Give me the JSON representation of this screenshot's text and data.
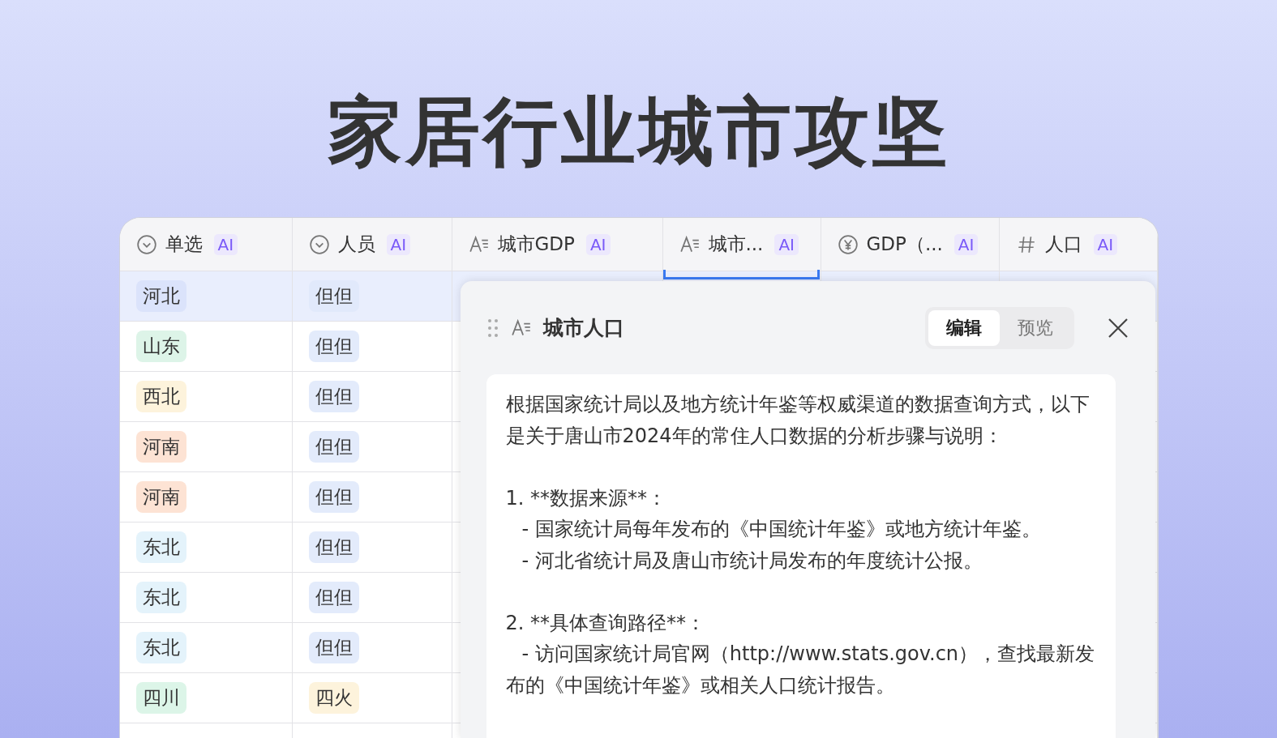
{
  "title": "家居行业城市攻坚",
  "table": {
    "columns": [
      {
        "kind": "select",
        "label": "单选",
        "badge": "AI"
      },
      {
        "kind": "select",
        "label": "人员",
        "badge": "AI"
      },
      {
        "kind": "text",
        "label": "城市GDP",
        "badge": "AI"
      },
      {
        "kind": "text",
        "label": "城市...",
        "badge": "AI"
      },
      {
        "kind": "currency",
        "label": "GDP（...",
        "badge": "AI"
      },
      {
        "kind": "number",
        "label": "人口",
        "badge": "AI"
      }
    ],
    "rows": [
      {
        "selected": true,
        "region": {
          "text": "河北",
          "color": "#dbe3fb"
        },
        "person": {
          "text": "但但",
          "color": "#e1e9fb"
        }
      },
      {
        "selected": false,
        "region": {
          "text": "山东",
          "color": "#ddf4e8"
        },
        "person": {
          "text": "但但",
          "color": "#e3ebfb"
        }
      },
      {
        "selected": false,
        "region": {
          "text": "西北",
          "color": "#fdf3dc"
        },
        "person": {
          "text": "但但",
          "color": "#e3ebfb"
        }
      },
      {
        "selected": false,
        "region": {
          "text": "河南",
          "color": "#fde3d4"
        },
        "person": {
          "text": "但但",
          "color": "#e3ebfb"
        }
      },
      {
        "selected": false,
        "region": {
          "text": "河南",
          "color": "#fde3d4"
        },
        "person": {
          "text": "但但",
          "color": "#e3ebfb"
        }
      },
      {
        "selected": false,
        "region": {
          "text": "东北",
          "color": "#e4f3fb"
        },
        "person": {
          "text": "但但",
          "color": "#e3ebfb"
        }
      },
      {
        "selected": false,
        "region": {
          "text": "东北",
          "color": "#e4f3fb"
        },
        "person": {
          "text": "但但",
          "color": "#e3ebfb"
        }
      },
      {
        "selected": false,
        "region": {
          "text": "东北",
          "color": "#e4f3fb"
        },
        "person": {
          "text": "但但",
          "color": "#e3ebfb"
        }
      },
      {
        "selected": false,
        "region": {
          "text": "四川",
          "color": "#dcf5e8"
        },
        "person": {
          "text": "四火",
          "color": "#fdf3dc"
        }
      }
    ]
  },
  "panel": {
    "title": "城市人口",
    "tabs": [
      {
        "label": "编辑",
        "selected": true
      },
      {
        "label": "预览",
        "selected": false
      }
    ],
    "content": [
      {
        "kind": "para",
        "text": "根据国家统计局以及地方统计年鉴等权威渠道的数据查询方式，以下是关于唐山市2024年的常住人口数据的分析步骤与说明："
      },
      {
        "kind": "blank"
      },
      {
        "kind": "item",
        "text": "1. **数据来源**："
      },
      {
        "kind": "sub",
        "text": "- 国家统计局每年发布的《中国统计年鉴》或地方统计年鉴。"
      },
      {
        "kind": "sub",
        "text": "- 河北省统计局及唐山市统计局发布的年度统计公报。"
      },
      {
        "kind": "blank"
      },
      {
        "kind": "item",
        "text": "2. **具体查询路径**："
      },
      {
        "kind": "sub",
        "text": "- 访问国家统计局官网（http://www.stats.gov.cn），查找最新发布的《中国统计年鉴》或相关人口统计报告。"
      }
    ]
  }
}
